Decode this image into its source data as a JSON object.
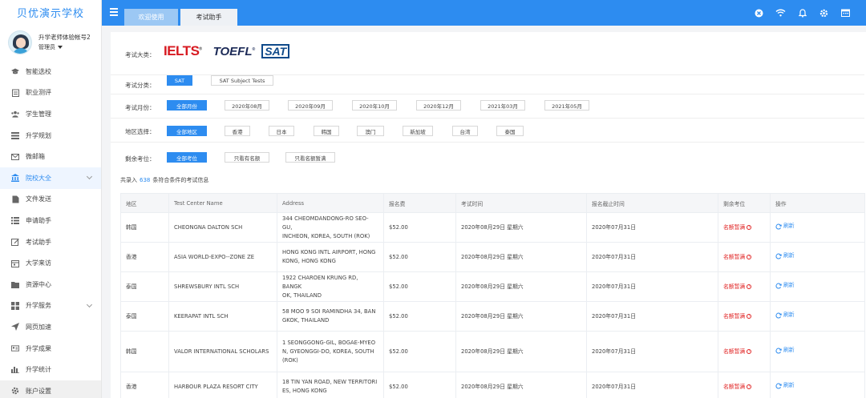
{
  "brand": "贝优演示学校",
  "profile": {
    "name": "升学老师体验帐号2",
    "role": "管理员"
  },
  "sidebar": {
    "items": [
      {
        "label": "智能选校",
        "icon": "mortarboard-icon"
      },
      {
        "label": "职业测评",
        "icon": "clipboard-icon"
      },
      {
        "label": "学生管理",
        "icon": "users-icon"
      },
      {
        "label": "升学规划",
        "icon": "list-icon"
      },
      {
        "label": "微邮箱",
        "icon": "mail-icon"
      },
      {
        "label": "院校大全",
        "icon": "institution-icon",
        "active": true,
        "expandable": true
      },
      {
        "label": "文件发送",
        "icon": "file-icon"
      },
      {
        "label": "申请助手",
        "icon": "list-icon"
      },
      {
        "label": "考试助手",
        "icon": "edit-icon"
      },
      {
        "label": "大学来访",
        "icon": "calendar-icon"
      },
      {
        "label": "资源中心",
        "icon": "folder-icon"
      },
      {
        "label": "升学服务",
        "icon": "grid-icon",
        "expandable": true
      },
      {
        "label": "网页加速",
        "icon": "send-icon"
      },
      {
        "label": "升学成果",
        "icon": "id-card-icon"
      },
      {
        "label": "升学统计",
        "icon": "bar-chart-icon"
      },
      {
        "label": "账户设置",
        "icon": "gear-icon"
      }
    ]
  },
  "tabs": [
    {
      "label": "欢迎使用"
    },
    {
      "label": "考试助手"
    }
  ],
  "toolbar": {
    "icons": [
      "close-circle-icon",
      "wifi-icon",
      "bell-icon",
      "gear-icon",
      "calendar-icon"
    ]
  },
  "filters": {
    "exam_label": "考试大类：",
    "exam_logos": {
      "ielts": "IELTS",
      "toefl": "TOEFL",
      "sat": "SAT"
    },
    "category_label": "考试分类：",
    "categories": [
      "SAT",
      "SAT Subject Tests"
    ],
    "month_label": "考试月份：",
    "months": [
      "全部月份",
      "2020年08月",
      "2020年09月",
      "2020年10月",
      "2020年12月",
      "2021年03月",
      "2021年05月"
    ],
    "region_label": "地区选择：",
    "regions": [
      "全部地区",
      "香港",
      "日本",
      "韩国",
      "澳门",
      "新加坡",
      "台湾",
      "泰国"
    ],
    "seats_label": "剩余考位：",
    "seats": [
      "全部考位",
      "只看有名额",
      "只看名额暂满"
    ]
  },
  "summary": {
    "prefix": "共录入",
    "count": "638",
    "suffix": "条符合条件的考试信息"
  },
  "table": {
    "headers": [
      "地区",
      "Test Center Name",
      "Address",
      "报名费",
      "考试时间",
      "报名截止时间",
      "剩余考位",
      "操作"
    ],
    "rows": [
      {
        "region": "韩国",
        "center": "CHEONGNA DALTON SCH",
        "address1": "344 CHEOMDANDONG-RO SEO-GU,",
        "address2": "INCHEON, KOREA, SOUTH (ROK)",
        "address3": "",
        "fee": "$52.00",
        "date": "2020年08月29日 星期六",
        "deadline": "2020年07月31日",
        "status": "名额暂满",
        "action": "刷新"
      },
      {
        "region": "香港",
        "center": "ASIA WORLD-EXPO--ZONE ZE",
        "address1": "HONG KONG INTL AIRPORT, HONG",
        "address2": "KONG, HONG KONG",
        "address3": "",
        "fee": "$52.00",
        "date": "2020年08月29日 星期六",
        "deadline": "2020年07月31日",
        "status": "名额暂满",
        "action": "刷新"
      },
      {
        "region": "泰国",
        "center": "SHREWSBURY INTL SCH",
        "address1": "1922 CHAROEN KRUNG RD, BANGK",
        "address2": "OK, THAILAND",
        "address3": "",
        "fee": "$52.00",
        "date": "2020年08月29日 星期六",
        "deadline": "2020年07月31日",
        "status": "名额暂满",
        "action": "刷新"
      },
      {
        "region": "泰国",
        "center": "KEERAPAT INTL SCH",
        "address1": "58 MOO 9 SOI RAMINDHA 34, BAN",
        "address2": "GKOK, THAILAND",
        "address3": "",
        "fee": "$52.00",
        "date": "2020年08月29日 星期六",
        "deadline": "2020年07月31日",
        "status": "名额暂满",
        "action": "刷新"
      },
      {
        "region": "韩国",
        "center": "VALOR INTERNATIONAL SCHOLARS",
        "address1": "1 SEONGGONG-GIL, BOGAE-MYEO",
        "address2": "N, GYEONGGI-DO, KOREA, SOUTH",
        "address3": "(ROK)",
        "fee": "$52.00",
        "date": "2020年08月29日 星期六",
        "deadline": "2020年07月31日",
        "status": "名额暂满",
        "action": "刷新"
      },
      {
        "region": "香港",
        "center": "HARBOUR PLAZA RESORT CITY",
        "address1": "18 TIN YAN ROAD, NEW TERRITORI",
        "address2": "ES, HONG KONG",
        "address3": "",
        "fee": "$52.00",
        "date": "2020年08月29日 星期六",
        "deadline": "2020年07月31日",
        "status": "名额暂满",
        "action": "刷新"
      }
    ]
  },
  "colors": {
    "primary": "#2d8cf0",
    "danger": "#e02020",
    "brand_text": "#2d8cf0"
  }
}
